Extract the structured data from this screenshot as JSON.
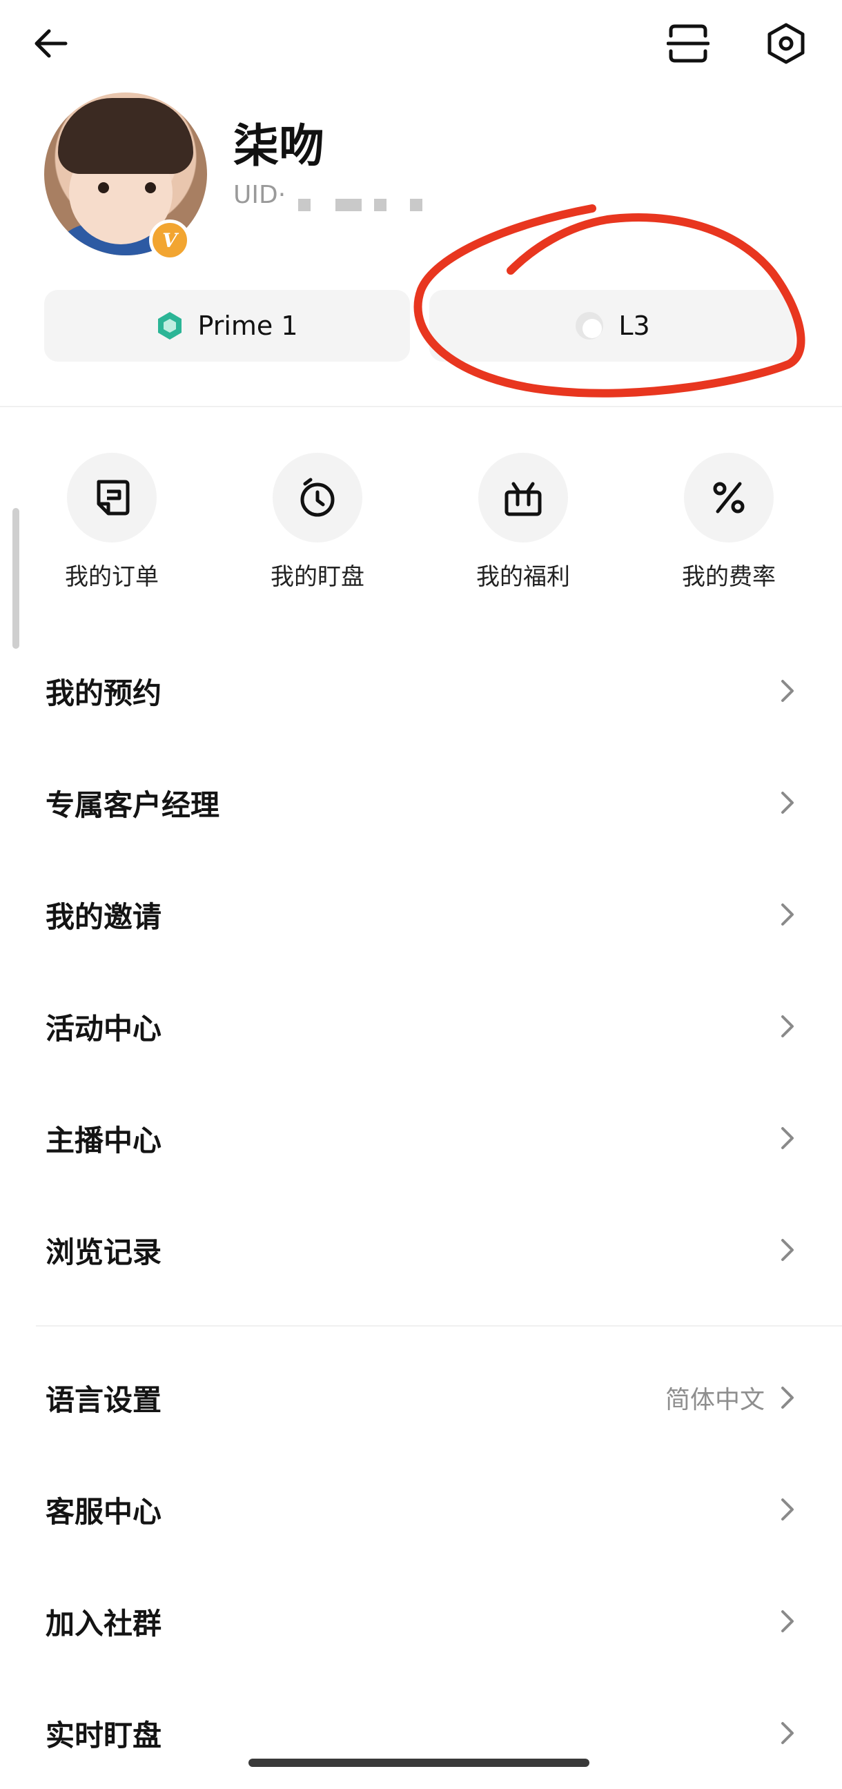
{
  "header": {
    "back_icon": "arrow-left-icon",
    "scan_icon": "scan-icon",
    "settings_icon": "hexagon-settings-icon"
  },
  "profile": {
    "username": "柒吻",
    "uid_label": "UID·",
    "verified_badge": "V"
  },
  "levels": {
    "prime_label": "Prime 1",
    "l_label": "L3"
  },
  "quick_actions": [
    {
      "label": "我的订单",
      "icon": "orders-icon"
    },
    {
      "label": "我的盯盘",
      "icon": "clock-watch-icon"
    },
    {
      "label": "我的福利",
      "icon": "gift-box-icon"
    },
    {
      "label": "我的费率",
      "icon": "percent-icon"
    }
  ],
  "menu": [
    {
      "label": "我的预约"
    },
    {
      "label": "专属客户经理"
    },
    {
      "label": "我的邀请"
    },
    {
      "label": "活动中心"
    },
    {
      "label": "主播中心"
    },
    {
      "label": "浏览记录"
    }
  ],
  "settings_menu": [
    {
      "label": "语言设置",
      "value": "简体中文"
    },
    {
      "label": "客服中心",
      "value": ""
    },
    {
      "label": "加入社群",
      "value": ""
    },
    {
      "label": "实时盯盘",
      "value": ""
    }
  ],
  "colors": {
    "annotation_red": "#e8361f",
    "prime_green": "#2bb596",
    "badge_orange": "#f2a531"
  }
}
